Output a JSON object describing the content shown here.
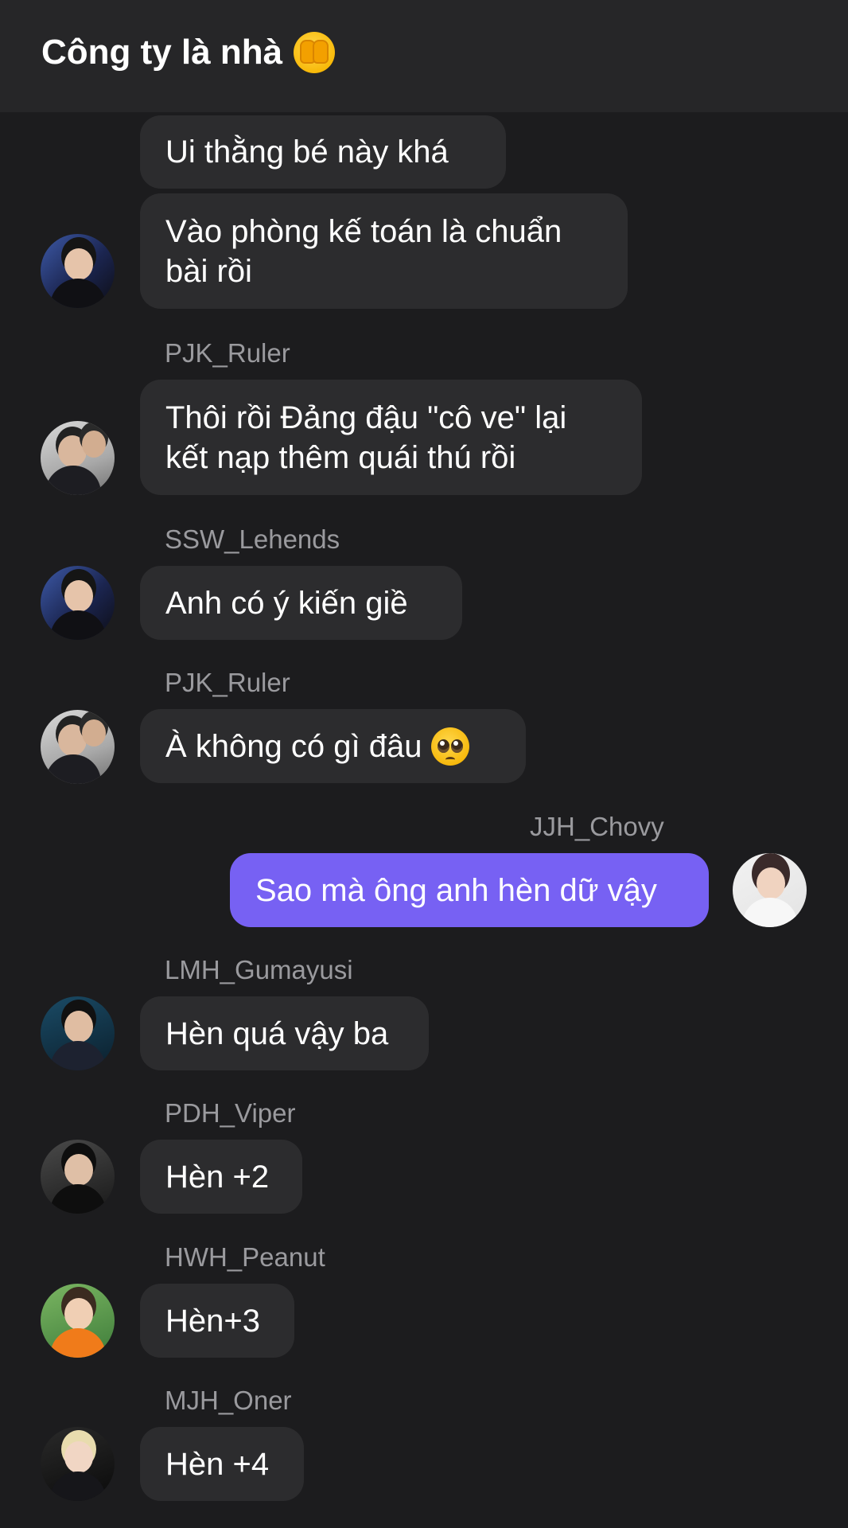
{
  "header": {
    "title": "Công ty là nhà",
    "title_emoji": "face-with-hands-over-mouth-emoji"
  },
  "messages": [
    {
      "sender": "",
      "text": "Ui thằng bé này khá",
      "mine": false
    },
    {
      "sender": "",
      "text": "Vào phòng kế toán là chuẩn bài rồi",
      "mine": false
    },
    {
      "sender": "PJK_Ruler",
      "text": "Thôi rồi Đảng đậu \"cô ve\" lại kết nạp thêm quái thú rồi",
      "mine": false
    },
    {
      "sender": "SSW_Lehends",
      "text": "Anh có ý kiến giề",
      "mine": false
    },
    {
      "sender": "PJK_Ruler",
      "text": "À không có gì đâu",
      "emoji": "pleading-face-emoji",
      "mine": false
    },
    {
      "sender": "JJH_Chovy",
      "text": "Sao mà ông anh hèn dữ vậy",
      "mine": true
    },
    {
      "sender": "LMH_Gumayusi",
      "text": "Hèn quá vậy ba",
      "mine": false
    },
    {
      "sender": "PDH_Viper",
      "text": "Hèn +2",
      "mine": false
    },
    {
      "sender": "HWH_Peanut",
      "text": "Hèn+3",
      "mine": false
    },
    {
      "sender": "MJH_Oner",
      "text": "Hèn +4",
      "mine": false
    }
  ],
  "colors": {
    "background": "#1c1c1e",
    "header": "#262628",
    "bubble_other": "#2c2c2e",
    "bubble_mine": "#7761f3",
    "sender_name": "#9a9a9e"
  }
}
